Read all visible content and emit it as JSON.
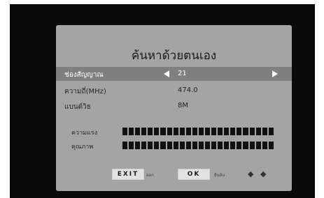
{
  "dialog": {
    "title": "ค้นหาด้วยตนเอง",
    "rows": [
      {
        "label": "ช่องสัญญาณ",
        "value": "21",
        "selected": true
      },
      {
        "label": "ความถี่(MHz)",
        "value": "474.0"
      },
      {
        "label": "แบนด์วิธ",
        "value": "8M"
      }
    ],
    "meters": [
      {
        "label": "ความแรง",
        "level": 1.0
      },
      {
        "label": "คุณภาพ",
        "level": 1.0
      }
    ],
    "footer": {
      "exit_label": "EXIT",
      "exit_hint": "ออก",
      "ok_label": "OK",
      "ok_hint": "ยืนยัน",
      "nav_arrows": "◆ ◆"
    }
  },
  "colors": {
    "panel": "#a4a4a4",
    "selected_row": "#7f7f7f",
    "screen": "#0a0a0a"
  }
}
